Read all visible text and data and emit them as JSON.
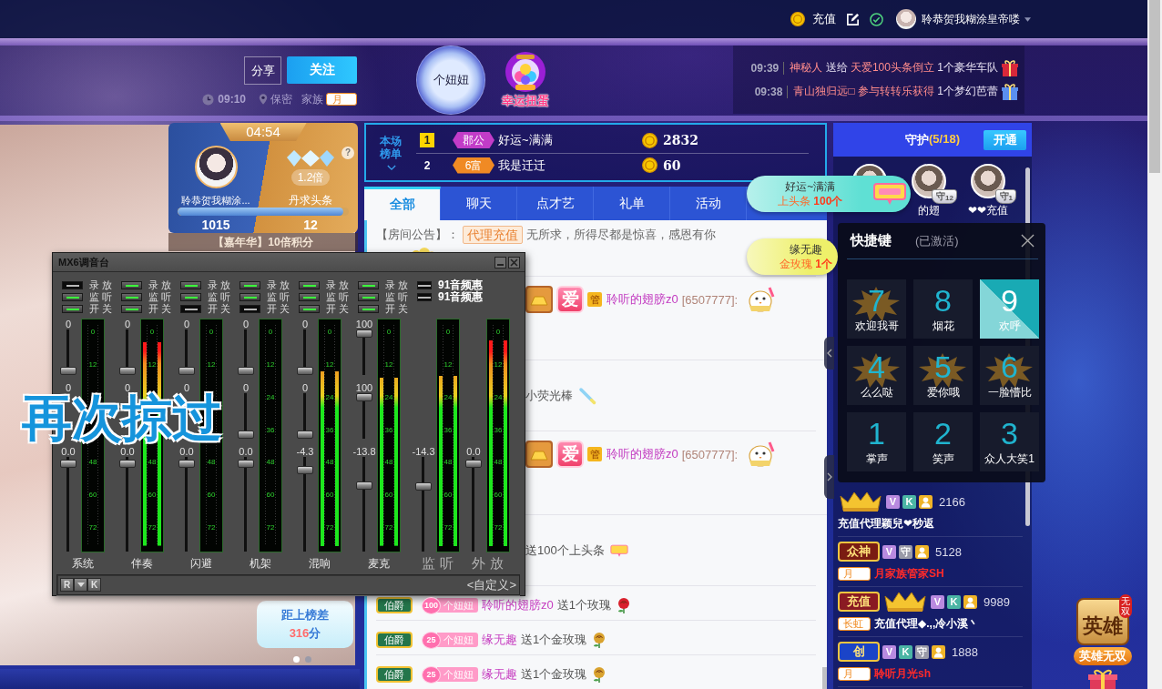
{
  "top_bar": {
    "recharge": "充值",
    "user": "聆恭贺我糊涂皇帝喽"
  },
  "header": {
    "share": "分享",
    "follow": "关注",
    "time": "09:10",
    "location": "保密",
    "family_label": "家族",
    "family_tag": "月",
    "fan_orb": "个妞妞",
    "lucky": "幸运扭蛋",
    "feed": [
      {
        "time": "09:39",
        "parts": [
          {
            "text": "神秘人",
            "highlight": true
          },
          {
            "text": "送给",
            "highlight": false
          },
          {
            "text": "天爱100头条倒立",
            "highlight": true
          },
          {
            "text": "1个豪华车队",
            "highlight": false
          }
        ],
        "color": "#d8283a"
      },
      {
        "time": "09:38",
        "parts": [
          {
            "text": "青山独归远□",
            "highlight": true
          },
          {
            "text": "参与转转乐获得",
            "highlight": true
          },
          {
            "text": "1个梦幻芭蕾",
            "highlight": false
          }
        ],
        "color": "#5a8ff0"
      }
    ]
  },
  "stage": {
    "pk": {
      "timer": "04:54",
      "host_name": "聆恭贺我糊涂...",
      "bonus": "1.2倍",
      "rival_name": "丹求头条",
      "level": 0.97,
      "host_score": "1015",
      "rival_score": "12",
      "help": "?"
    },
    "carnival": "【嘉年华】10倍积分",
    "rank_gap": {
      "label": "距上榜差",
      "value": "316",
      "unit": "分"
    },
    "dots": [
      {
        "selected": true
      },
      {
        "selected": false
      }
    ]
  },
  "lyric": "再次掠过",
  "mixer": {
    "title": "MX6调音台",
    "channels": [
      {
        "kind": "input",
        "name": "系统",
        "toggles": [
          {
            "label": "录 放",
            "on": false
          },
          {
            "label": "监 听",
            "on": true
          },
          {
            "label": "开 关",
            "on": true
          }
        ],
        "sliders": [
          {
            "value": "0",
            "level": 0
          },
          {
            "value": "0"
          },
          {
            "value": "0.0",
            "level": 0.97
          }
        ],
        "scale_upper": [
          "0",
          "12"
        ],
        "scale_lower": [
          "48",
          "60",
          "72"
        ]
      },
      {
        "kind": "input",
        "name": "伴奏",
        "toggles": [
          {
            "label": "录 放",
            "on": true
          },
          {
            "label": "监 听",
            "on": true
          },
          {
            "label": "开 关",
            "on": true
          }
        ],
        "sliders": [
          {
            "value": "0",
            "level": 0
          },
          {
            "value": "0"
          },
          {
            "value": "0.0",
            "level": 0.97
          }
        ],
        "level": 0.92,
        "scale_upper": [
          "0",
          "12"
        ],
        "scale_lower": [
          "48",
          "60",
          "72"
        ]
      },
      {
        "kind": "input",
        "name": "闪避",
        "toggles": [
          {
            "label": "录 放",
            "on": true
          },
          {
            "label": "监 听",
            "on": true
          },
          {
            "label": "开 关",
            "on": false
          }
        ],
        "sliders": [
          {
            "value": "0",
            "level": 0
          },
          {
            "value": "0"
          },
          {
            "value": "0.0",
            "level": 0.97
          }
        ],
        "scale_upper": [
          "0",
          "12"
        ],
        "scale_lower": [
          "48",
          "60",
          "72"
        ]
      },
      {
        "kind": "input",
        "name": "机架",
        "toggles": [
          {
            "label": "录 放",
            "on": true
          },
          {
            "label": "监 听",
            "on": true
          },
          {
            "label": "开 关",
            "on": false
          }
        ],
        "sliders": [
          {
            "value": "0",
            "level": 0
          },
          {
            "value": "0",
            "level": 0
          },
          {
            "value": "0.0",
            "level": 0.97
          }
        ],
        "scale_upper": [
          "0",
          "12",
          "24",
          "36"
        ],
        "scale_lower": [
          "48",
          "60",
          "72"
        ]
      },
      {
        "kind": "input",
        "name": "混响",
        "toggles": [
          {
            "label": "录 放",
            "on": true
          },
          {
            "label": "监 听",
            "on": true
          },
          {
            "label": "开 关",
            "on": true
          }
        ],
        "sliders": [
          {
            "value": "0",
            "level": 0
          },
          {
            "value": "0",
            "level": 0
          },
          {
            "value": "-4.3",
            "level": 0.9
          }
        ],
        "level": 0.79,
        "scale_upper": [
          "0",
          "12",
          "24",
          "36"
        ],
        "scale_lower": [
          "48",
          "60",
          "72"
        ]
      },
      {
        "kind": "input",
        "name": "麦克",
        "toggles": [
          {
            "label": "录 放",
            "on": true
          },
          {
            "label": "监 听",
            "on": true
          },
          {
            "label": "开 关",
            "on": true
          }
        ],
        "sliders": [
          {
            "value": "100",
            "level": 1
          },
          {
            "value": "100",
            "level": 1
          },
          {
            "value": "-13.8",
            "level": 0.72
          }
        ],
        "level": 0.76,
        "scale_upper": [
          "0",
          "12",
          "24",
          "36"
        ],
        "scale_lower": [
          "48",
          "60",
          "72"
        ]
      },
      {
        "kind": "output",
        "name": "监 听",
        "sliders": [
          {
            "value": "-14.3",
            "level": 0.71
          }
        ],
        "level": 0.77,
        "scale_upper": [
          "0",
          "12",
          "24",
          "36"
        ],
        "scale_lower": [
          "48",
          "60",
          "72"
        ]
      },
      {
        "kind": "output",
        "name": "外 放",
        "sliders": [
          {
            "value": "0.0",
            "level": 0.97
          }
        ],
        "level": 0.93,
        "scale_upper": [
          "0",
          "12",
          "24",
          "36"
        ],
        "scale_lower": [
          "48",
          "60",
          "72"
        ]
      }
    ],
    "extras": [
      {
        "label": "91音频惠",
        "on": false
      },
      {
        "label": "91音频惠",
        "on": false
      }
    ],
    "buttons": [
      {
        "kind": "text",
        "label": "R"
      },
      {
        "kind": "menu"
      },
      {
        "kind": "text",
        "label": "K"
      }
    ],
    "preset": "<自定义>"
  },
  "rank_board": {
    "title": "本场榜单",
    "rows": [
      {
        "rank": "1",
        "highlighted": true,
        "badge": "郡公",
        "color": "#c23cc8",
        "name": "好运~满满",
        "score": "2832"
      },
      {
        "rank": "2",
        "highlighted": false,
        "badge": "6富",
        "color": "#f08a24",
        "name": "我是迁迁",
        "score": "60"
      }
    ]
  },
  "tabs": [
    {
      "label": "全部",
      "selected": true
    },
    {
      "label": "聊天",
      "selected": false
    },
    {
      "label": "点才艺",
      "selected": false
    },
    {
      "label": "礼单",
      "selected": false
    },
    {
      "label": "活动",
      "selected": false
    }
  ],
  "messages": [
    {
      "kind": "notice",
      "label": "【房间公告】：",
      "tag": "代理充值",
      "text": "无所求，所得尽都是惊喜，感恩有你"
    },
    {
      "kind": "chat",
      "badges": [
        {
          "kind": "ingot"
        },
        {
          "kind": "love",
          "text": "爱"
        },
        {
          "kind": "admin",
          "text": "管"
        }
      ],
      "name": "聆听的翅膀z0",
      "uid": "[6507777]:",
      "sticker": true
    },
    {
      "kind": "text",
      "text": "小荧光棒",
      "item": {
        "kind": "stick"
      }
    },
    {
      "kind": "chat",
      "badges": [
        {
          "kind": "ingot"
        },
        {
          "kind": "love",
          "text": "爱"
        },
        {
          "kind": "admin",
          "text": "管"
        }
      ],
      "name": "聆听的翅膀z0",
      "uid": "[6507777]:",
      "sticker": true
    },
    {
      "kind": "text",
      "text": "送100个上头条",
      "item": {
        "kind": "sign"
      }
    },
    {
      "kind": "gift",
      "rank": "伯爵",
      "fan_level": "100",
      "fan_club": "个妞妞",
      "name": "聆听的翅膀z0",
      "text": "送1个玫瑰",
      "item": {
        "kind": "rose",
        "color": "#d8202c"
      }
    },
    {
      "kind": "gift",
      "rank": "伯爵",
      "fan_level": "25",
      "fan_club": "个妞妞",
      "name": "缘无趣",
      "text": "送1个金玫瑰",
      "item": {
        "kind": "rose",
        "color": "#d9a22e"
      }
    },
    {
      "kind": "gift",
      "rank": "伯爵",
      "fan_level": "25",
      "fan_club": "个妞妞",
      "name": "缘无趣",
      "text": "送1个金玫瑰",
      "item": {
        "kind": "rose",
        "color": "#d9a22e"
      }
    }
  ],
  "banners": [
    {
      "name": "好运~满满",
      "gift": "上头条",
      "count": "100个",
      "color": "#5fe0d4",
      "sign": true
    },
    {
      "name": "缘无趣",
      "gift": "金玫瑰",
      "count": "1个",
      "color": "#eef06a",
      "sign": false
    }
  ],
  "guard": {
    "title": "守护",
    "count": "(5/18)",
    "button": "开通",
    "members": [
      {
        "kind": "plain"
      },
      {
        "kind": "badged",
        "badge": "守",
        "rank": "12",
        "name": "的翅"
      },
      {
        "kind": "badged",
        "badge": "守",
        "rank": "1",
        "name": "❤❤充值"
      }
    ]
  },
  "shortcuts": {
    "title": "快捷键",
    "status": "(已激活)",
    "keys": [
      {
        "key": "7",
        "label": "欢迎我哥",
        "selected": false,
        "sticker": true
      },
      {
        "key": "8",
        "label": "烟花",
        "selected": false,
        "sticker": false
      },
      {
        "key": "9",
        "label": "欢呼",
        "selected": true,
        "sticker": false
      },
      {
        "key": "4",
        "label": "么么哒",
        "selected": false,
        "sticker": true
      },
      {
        "key": "5",
        "label": "爱你哦",
        "selected": false,
        "sticker": true
      },
      {
        "key": "6",
        "label": "一脸懵比",
        "selected": false,
        "sticker": true
      },
      {
        "key": "1",
        "label": "掌声",
        "selected": false,
        "sticker": false
      },
      {
        "key": "2",
        "label": "笑声",
        "selected": false,
        "sticker": false
      },
      {
        "key": "3",
        "label": "众人大笑1",
        "selected": false,
        "sticker": false
      }
    ]
  },
  "viewers": [
    {
      "badges": [
        {
          "kind": "crown"
        },
        {
          "kind": "letter",
          "text": "V",
          "color": "#b98ae0"
        },
        {
          "kind": "letter",
          "text": "K",
          "color": "#4bb5a5"
        },
        {
          "kind": "user"
        }
      ],
      "score": "2166",
      "name": "充值代理颖兒❤秒返",
      "color": "#ffffff"
    },
    {
      "badges": [
        {
          "kind": "title",
          "text": "众神",
          "color": "#7a1c12"
        },
        {
          "kind": "letter",
          "text": "V",
          "color": "#b98ae0"
        },
        {
          "kind": "letter",
          "text": "守",
          "color": "#9a9aa8"
        },
        {
          "kind": "user"
        }
      ],
      "score": "5128",
      "tag": "月",
      "name": "月家族管家SH",
      "color": "#ff2a2a"
    },
    {
      "badges": [
        {
          "kind": "title",
          "text": "充值",
          "color": "#8a1a22"
        },
        {
          "kind": "crown"
        },
        {
          "kind": "letter",
          "text": "V",
          "color": "#b98ae0"
        },
        {
          "kind": "letter",
          "text": "K",
          "color": "#4bb5a5"
        },
        {
          "kind": "user"
        }
      ],
      "score": "9989",
      "tag": "长虹",
      "name": "充值代理◆.,,冷小溪丶",
      "color": "#ffffff"
    },
    {
      "badges": [
        {
          "kind": "title",
          "text": "创",
          "color": "#1a44c8"
        },
        {
          "kind": "letter",
          "text": "V",
          "color": "#b98ae0"
        },
        {
          "kind": "letter",
          "text": "K",
          "color": "#4bb5a5"
        },
        {
          "kind": "letter",
          "text": "守",
          "color": "#9a9aa8"
        },
        {
          "kind": "user"
        }
      ],
      "score": "1888",
      "tag": "月",
      "name": "聆听月光sh",
      "color": "#ff2a2a"
    }
  ],
  "game": {
    "seal": "无双",
    "title": "英雄",
    "label": "英雄无双"
  }
}
